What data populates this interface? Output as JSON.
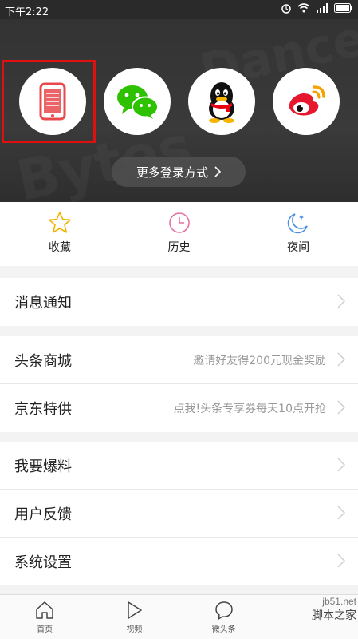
{
  "status_bar": {
    "time": "下午2:22"
  },
  "login": {
    "options": [
      "phone-login-icon",
      "wechat-icon",
      "qq-icon",
      "weibo-icon"
    ],
    "more_label": "更多登录方式"
  },
  "quick_actions": [
    {
      "label": "收藏",
      "icon": "star-icon"
    },
    {
      "label": "历史",
      "icon": "history-icon"
    },
    {
      "label": "夜间",
      "icon": "night-mode-icon"
    }
  ],
  "menu": {
    "notifications": {
      "title": "消息通知"
    },
    "mall": {
      "title": "头条商城",
      "subtitle": "邀请好友得200元现金奖励"
    },
    "jd": {
      "title": "京东特供",
      "subtitle": "点我!头条专享券每天10点开抢"
    },
    "tip_off": {
      "title": "我要爆料"
    },
    "feedback": {
      "title": "用户反馈"
    },
    "settings": {
      "title": "系统设置"
    }
  },
  "bottom_nav": [
    {
      "label": "首页",
      "icon": "home-icon"
    },
    {
      "label": "视频",
      "icon": "video-play-icon"
    },
    {
      "label": "微头条",
      "icon": "chat-bubble-icon"
    }
  ],
  "watermark": {
    "site": "jb51.net",
    "name": "脚本之家"
  },
  "colors": {
    "accent_red": "#e8494d",
    "highlight": "#e01010",
    "wechat": "#2dc100",
    "weibo": "#e6162d"
  }
}
